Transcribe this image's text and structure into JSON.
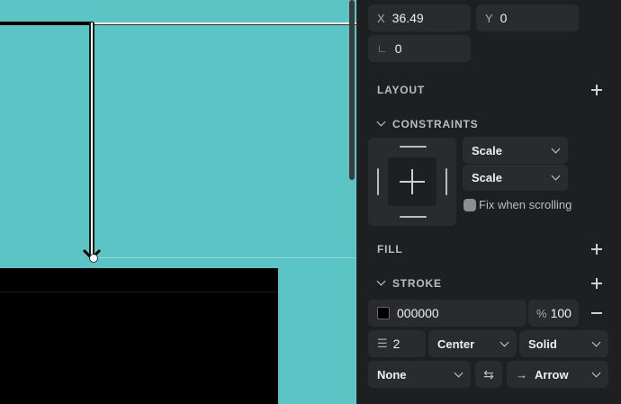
{
  "position": {
    "x_label": "X",
    "x_value": "36.49",
    "y_label": "Y",
    "y_value": "0",
    "rotation_value": "0"
  },
  "sections": {
    "layout": "LAYOUT",
    "constraints": "CONSTRAINTS",
    "fill": "FILL",
    "stroke": "STROKE"
  },
  "constraints": {
    "horizontal": "Scale",
    "vertical": "Scale",
    "fix_scrolling_label": "Fix when scrolling"
  },
  "stroke": {
    "color_hex": "000000",
    "opacity_unit": "%",
    "opacity": "100",
    "width": "2",
    "align": "Center",
    "style": "Solid",
    "start_cap": "None",
    "end_cap": "Arrow"
  }
}
